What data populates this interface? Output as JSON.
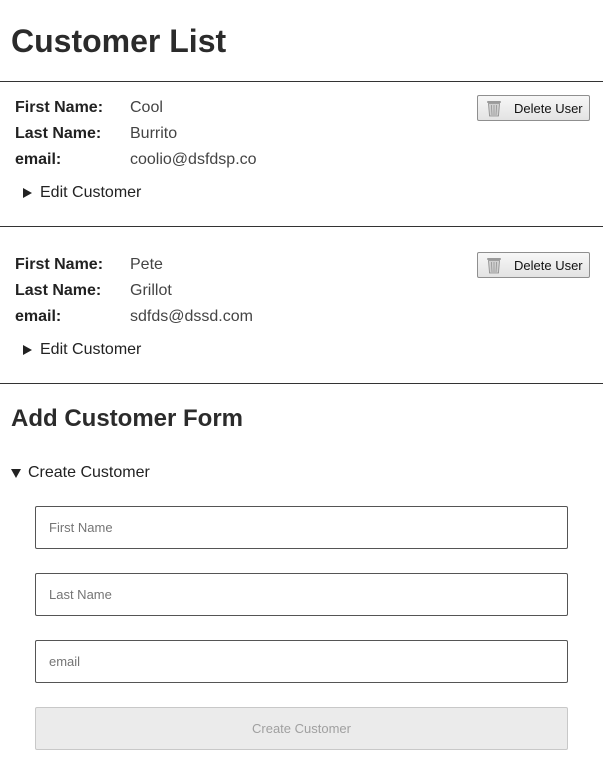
{
  "header": {
    "title": "Customer List"
  },
  "customers": [
    {
      "first_name_label": "First Name:",
      "first_name": "Cool",
      "last_name_label": "Last Name:",
      "last_name": "Burrito",
      "email_label": "email:",
      "email": "coolio@dsfdsp.co",
      "delete_label": "Delete User",
      "edit_label": "Edit Customer"
    },
    {
      "first_name_label": "First Name:",
      "first_name": "Pete",
      "last_name_label": "Last Name:",
      "last_name": "Grillot",
      "email_label": "email:",
      "email": "sdfds@dssd.com",
      "delete_label": "Delete User",
      "edit_label": "Edit Customer"
    }
  ],
  "add_form": {
    "title": "Add Customer Form",
    "toggle_label": "Create Customer",
    "first_name_placeholder": "First Name",
    "last_name_placeholder": "Last Name",
    "email_placeholder": "email",
    "submit_label": "Create Customer",
    "submit_enabled": false
  },
  "icons": {
    "delete": "trash-icon",
    "collapsed": "disclosure-triangle-right-icon",
    "expanded": "disclosure-triangle-down-icon"
  },
  "colors": {
    "text": "#333333",
    "divider": "#333333",
    "disabled_button_bg": "#ebebeb",
    "disabled_button_text": "#a0a0a0"
  }
}
